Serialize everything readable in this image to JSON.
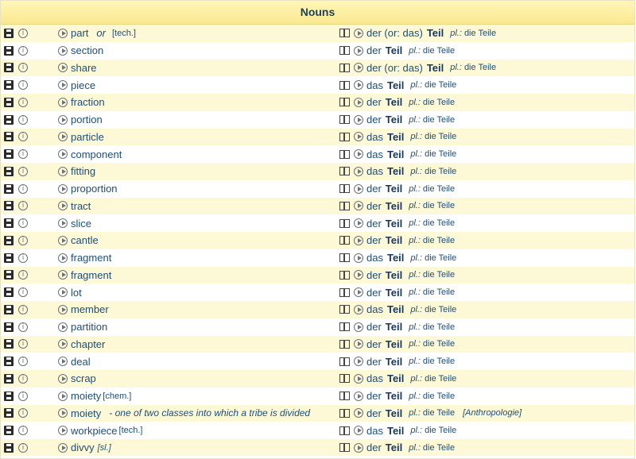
{
  "section_title": "Nouns",
  "rows": [
    {
      "en": "part",
      "or": "or",
      "tag": "[tech.]",
      "art": "der (or: das)",
      "de": "Teil",
      "pl_label": "pl.:",
      "pl": "die Teile"
    },
    {
      "en": "section",
      "art": "der",
      "de": "Teil",
      "pl_label": "pl.:",
      "pl": "die Teile"
    },
    {
      "en": "share",
      "art": "der (or: das)",
      "de": "Teil",
      "pl_label": "pl.:",
      "pl": "die Teile"
    },
    {
      "en": "piece",
      "art": "das",
      "de": "Teil",
      "pl_label": "pl.:",
      "pl": "die Teile"
    },
    {
      "en": "fraction",
      "art": "der",
      "de": "Teil",
      "pl_label": "pl.:",
      "pl": "die Teile"
    },
    {
      "en": "portion",
      "art": "der",
      "de": "Teil",
      "pl_label": "pl.:",
      "pl": "die Teile"
    },
    {
      "en": "particle",
      "art": "das",
      "de": "Teil",
      "pl_label": "pl.:",
      "pl": "die Teile"
    },
    {
      "en": "component",
      "art": "das",
      "de": "Teil",
      "pl_label": "pl.:",
      "pl": "die Teile"
    },
    {
      "en": "fitting",
      "art": "das",
      "de": "Teil",
      "pl_label": "pl.:",
      "pl": "die Teile"
    },
    {
      "en": "proportion",
      "art": "der",
      "de": "Teil",
      "pl_label": "pl.:",
      "pl": "die Teile"
    },
    {
      "en": "tract",
      "art": "der",
      "de": "Teil",
      "pl_label": "pl.:",
      "pl": "die Teile"
    },
    {
      "en": "slice",
      "art": "der",
      "de": "Teil",
      "pl_label": "pl.:",
      "pl": "die Teile"
    },
    {
      "en": "cantle",
      "art": "der",
      "de": "Teil",
      "pl_label": "pl.:",
      "pl": "die Teile"
    },
    {
      "en": "fragment",
      "art": "das",
      "de": "Teil",
      "pl_label": "pl.:",
      "pl": "die Teile"
    },
    {
      "en": "fragment",
      "art": "der",
      "de": "Teil",
      "pl_label": "pl.:",
      "pl": "die Teile"
    },
    {
      "en": "lot",
      "art": "der",
      "de": "Teil",
      "pl_label": "pl.:",
      "pl": "die Teile"
    },
    {
      "en": "member",
      "art": "das",
      "de": "Teil",
      "pl_label": "pl.:",
      "pl": "die Teile"
    },
    {
      "en": "partition",
      "art": "der",
      "de": "Teil",
      "pl_label": "pl.:",
      "pl": "die Teile"
    },
    {
      "en": "chapter",
      "art": "der",
      "de": "Teil",
      "pl_label": "pl.:",
      "pl": "die Teile"
    },
    {
      "en": "deal",
      "art": "der",
      "de": "Teil",
      "pl_label": "pl.:",
      "pl": "die Teile"
    },
    {
      "en": "scrap",
      "art": "das",
      "de": "Teil",
      "pl_label": "pl.:",
      "pl": "die Teile"
    },
    {
      "en": "moiety",
      "tag": "[chem.]",
      "art": "der",
      "de": "Teil",
      "pl_label": "pl.:",
      "pl": "die Teile"
    },
    {
      "en": "moiety",
      "def": "- one of two classes into which a tribe is divided",
      "art": "der",
      "de": "Teil",
      "pl_label": "pl.:",
      "pl": "die Teile",
      "tag_de": "[Anthropologie]"
    },
    {
      "en": "workpiece",
      "tag": "[tech.]",
      "art": "das",
      "de": "Teil",
      "pl_label": "pl.:",
      "pl": "die Teile"
    },
    {
      "en": "divvy",
      "sl": "[sl.]",
      "art": "der",
      "de": "Teil",
      "pl_label": "pl.:",
      "pl": "die Teile"
    }
  ]
}
